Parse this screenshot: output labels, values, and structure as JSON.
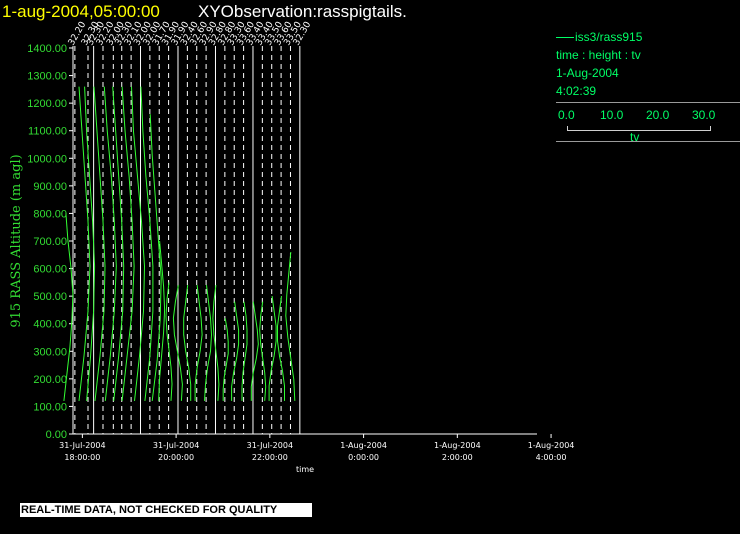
{
  "header": {
    "date_time": "1-aug-2004,05:00:00",
    "observation": "XYObservation:rasspigtails."
  },
  "legend": {
    "source": "iss3/rass915",
    "axes_desc": "time : height : tv",
    "date": "1-Aug-2004",
    "time": "4:02:39",
    "scale_ticks": [
      "0.0",
      "10.0",
      "20.0",
      "30.0"
    ],
    "scale_label": "tv"
  },
  "footer": {
    "qc_note": "REAL-TIME DATA, NOT CHECKED FOR QUALITY"
  },
  "colors": {
    "background": "#000000",
    "trace": "#33ff33",
    "axis": "#ffffff",
    "y_axis_text": "#33dd33",
    "date_title": "#ffff00"
  },
  "chart_data": {
    "type": "line",
    "title": "",
    "xlabel": "time",
    "ylabel": "915 RASS Altitude (m agl)",
    "ylim": [
      0,
      1400
    ],
    "y_ticks": [
      0,
      100,
      200,
      300,
      400,
      500,
      600,
      700,
      800,
      900,
      1000,
      1100,
      1200,
      1300,
      1400
    ],
    "y_tick_labels": [
      "0.00",
      "100.00",
      "200.00",
      "300.00",
      "400.00",
      "500.00",
      "600.00",
      "700.00",
      "800.00",
      "900.00",
      "1000.00",
      "1100.00",
      "1200.00",
      "1300.00",
      "1400.00"
    ],
    "x_range_hours": [
      16.9,
      21.85
    ],
    "x_ticks": [
      {
        "hour": 17.0,
        "date": "31-Jul-2004",
        "time": "18:00:00"
      },
      {
        "hour": 18.0,
        "date": "31-Jul-2004",
        "time": "20:00:00"
      },
      {
        "hour": 19.0,
        "date": "31-Jul-2004",
        "time": "22:00:00"
      },
      {
        "hour": 20.0,
        "date": "1-Aug-2004",
        "time": "0:00:00"
      },
      {
        "hour": 21.0,
        "date": "1-Aug-2004",
        "time": "2:00:00"
      },
      {
        "hour": 22.0,
        "date": "1-Aug-2004",
        "time": "4:00:00"
      }
    ],
    "profiles": [
      {
        "label": "32.20",
        "solid": false,
        "top": 800,
        "shape": [
          0,
          2,
          5,
          7,
          6,
          4,
          1,
          -2
        ]
      },
      {
        "label": "32.30",
        "solid": false,
        "top": 1260,
        "shape": [
          0,
          3,
          6,
          9,
          11,
          9,
          5,
          0
        ]
      },
      {
        "label": "32.30",
        "solid": true,
        "top": 1260,
        "shape": [
          0,
          2,
          5,
          8,
          10,
          9,
          6,
          2
        ]
      },
      {
        "label": "32.20",
        "solid": false,
        "top": 1260,
        "shape": [
          0,
          3,
          6,
          9,
          11,
          10,
          6,
          1
        ]
      },
      {
        "label": "32.00",
        "solid": false,
        "top": 1260,
        "shape": [
          0,
          3,
          7,
          10,
          12,
          10,
          6,
          1
        ]
      },
      {
        "label": "32.30",
        "solid": false,
        "top": 1260,
        "shape": [
          0,
          3,
          6,
          9,
          11,
          10,
          6,
          1
        ]
      },
      {
        "label": "32.10",
        "solid": false,
        "top": 1260,
        "shape": [
          0,
          3,
          7,
          10,
          12,
          10,
          5,
          0
        ]
      },
      {
        "label": "32.00",
        "solid": true,
        "top": 1260,
        "shape": [
          0,
          2,
          6,
          10,
          13,
          12,
          8,
          3
        ]
      },
      {
        "label": "32.00",
        "solid": false,
        "top": 1260,
        "shape": [
          0,
          2,
          5,
          9,
          12,
          12,
          9,
          4
        ]
      },
      {
        "label": "31.70",
        "solid": false,
        "top": 1160,
        "shape": [
          0,
          2,
          5,
          8,
          11,
          10,
          7,
          2
        ]
      },
      {
        "label": "31.90",
        "solid": false,
        "top": 700,
        "shape": [
          0,
          2,
          4,
          5,
          4,
          2,
          0,
          -1
        ]
      },
      {
        "label": "31.90",
        "solid": true,
        "top": 550,
        "shape": [
          0,
          -2,
          -3,
          -2,
          0,
          2,
          3,
          2
        ]
      },
      {
        "label": "32.40",
        "solid": false,
        "top": 540,
        "shape": [
          0,
          -3,
          -5,
          -4,
          -1,
          2,
          4,
          3
        ]
      },
      {
        "label": "32.60",
        "solid": false,
        "top": 540,
        "shape": [
          0,
          -2,
          -4,
          -4,
          -2,
          1,
          3,
          3
        ]
      },
      {
        "label": "32.90",
        "solid": false,
        "top": 540,
        "shape": [
          0,
          2,
          4,
          5,
          3,
          0,
          -2,
          -2
        ]
      },
      {
        "label": "32.80",
        "solid": true,
        "top": 540,
        "shape": [
          0,
          2,
          4,
          5,
          4,
          1,
          -1,
          -2
        ]
      },
      {
        "label": "32.80",
        "solid": false,
        "top": 540,
        "shape": [
          0,
          -2,
          -3,
          -2,
          0,
          2,
          3,
          2
        ]
      },
      {
        "label": "33.30",
        "solid": false,
        "top": 420,
        "shape": [
          0,
          2,
          3,
          3,
          1,
          -1,
          -2,
          -2
        ]
      },
      {
        "label": "33.60",
        "solid": false,
        "top": 480,
        "shape": [
          0,
          2,
          4,
          4,
          2,
          -1,
          -3,
          -3
        ]
      },
      {
        "label": "33.40",
        "solid": true,
        "top": 480,
        "shape": [
          0,
          2,
          3,
          3,
          1,
          -1,
          -2,
          -2
        ]
      },
      {
        "label": "33.40",
        "solid": false,
        "top": 480,
        "shape": [
          0,
          2,
          4,
          5,
          3,
          0,
          -2,
          -2
        ]
      },
      {
        "label": "33.50",
        "solid": false,
        "top": 480,
        "shape": [
          0,
          -2,
          -3,
          -2,
          0,
          2,
          3,
          2
        ]
      },
      {
        "label": "33.60",
        "solid": false,
        "top": 500,
        "shape": [
          0,
          2,
          4,
          4,
          2,
          -1,
          -3,
          -3
        ]
      },
      {
        "label": "33.50",
        "solid": false,
        "top": 500,
        "shape": [
          0,
          -2,
          -4,
          -4,
          -2,
          1,
          3,
          3
        ]
      },
      {
        "label": "32.30",
        "solid": true,
        "top": 660,
        "shape": [
          0,
          -2,
          -4,
          -5,
          -3,
          0,
          3,
          4
        ]
      }
    ],
    "profile_x_hours": [
      16.92,
      17.06,
      17.12,
      17.22,
      17.33,
      17.42,
      17.52,
      17.62,
      17.72,
      17.82,
      17.92,
      18.02,
      18.12,
      18.22,
      18.32,
      18.42,
      18.52,
      18.62,
      18.72,
      18.82,
      18.92,
      19.02,
      19.12,
      19.22,
      19.32
    ],
    "profile_bottom": 120
  }
}
